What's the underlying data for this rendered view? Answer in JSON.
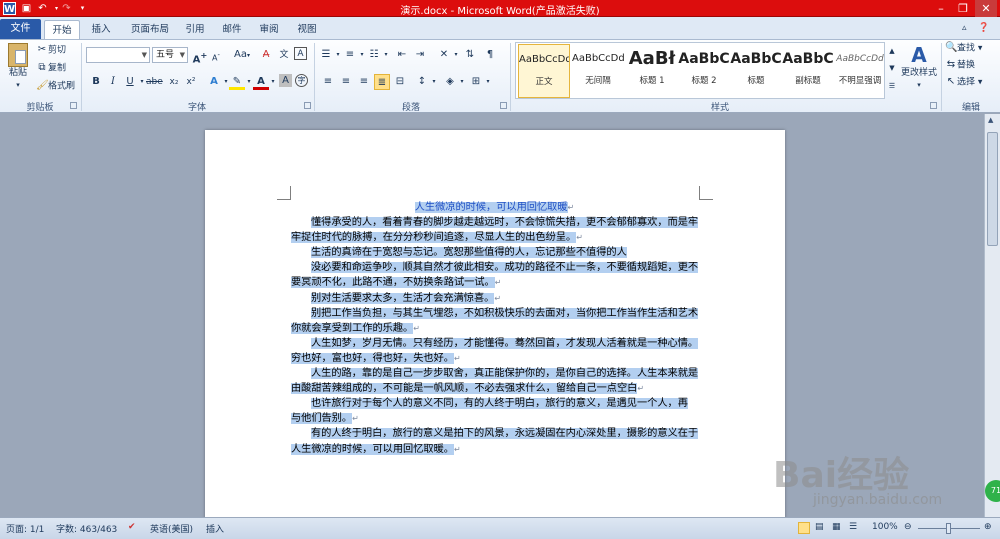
{
  "window": {
    "title": "演示.docx - Microsoft Word(产品激活失败)",
    "colors": {
      "titlebar": "#dc0d0d",
      "file_tab": "#2a5aa8",
      "selection": "#b3cff0",
      "doc_title_blue": "#1f4fc4"
    }
  },
  "quick_access": {
    "items": [
      "word-logo-icon",
      "save-icon",
      "undo-icon",
      "redo-icon",
      "customize-icon"
    ]
  },
  "tabs": {
    "file": "文件",
    "items": [
      {
        "label": "开始"
      },
      {
        "label": "插入"
      },
      {
        "label": "页面布局"
      },
      {
        "label": "引用"
      },
      {
        "label": "邮件"
      },
      {
        "label": "审阅"
      },
      {
        "label": "视图"
      }
    ],
    "active": "开始"
  },
  "ribbon": {
    "clipboard": {
      "paste": "粘贴",
      "cut": "剪切",
      "copy": "复制",
      "format_painter": "格式刷",
      "label": "剪贴板"
    },
    "font": {
      "font_name": "",
      "font_size": "五号",
      "change_case": "Aa",
      "label": "字体"
    },
    "paragraph": {
      "label": "段落"
    },
    "styles": {
      "items": [
        {
          "preview": "AaBbCcDd",
          "name": "正文"
        },
        {
          "preview": "AaBbCcDd",
          "name": "无间隔"
        },
        {
          "preview": "AaBł",
          "name": "标题 1"
        },
        {
          "preview": "AaBbC",
          "name": "标题 2"
        },
        {
          "preview": "AaBbC",
          "name": "标题"
        },
        {
          "preview": "AaBbC",
          "name": "副标题"
        },
        {
          "preview": "AaBbCcDd",
          "name": "不明显强调"
        }
      ],
      "selected": "正文",
      "change_styles": "更改样式",
      "label": "样式"
    },
    "editing": {
      "find": "查找",
      "replace": "替换",
      "select": "选择",
      "label": "编辑"
    }
  },
  "document": {
    "lines": [
      "人生微凉的时候，可以用回忆取暖",
      "懂得承受的人，看着青春的脚步越走越远时，不会惊慌失措，更不会郁郁寡欢，而是牢",
      "牢捉住时代的脉搏，在分分秒秒间追逐，尽显人生的出色纷呈。",
      "生活的真谛在于宽恕与忘记。宽恕那些值得的人，忘记那些不值得的人",
      "没必要和命运争吵，顺其自然才彼此相安。成功的路径不止一条，不要循规蹈矩，更不",
      "要冥顽不化，此路不通，不妨换条路试一试。",
      "别对生活要求太多，生活才会充满惊喜。",
      "别把工作当负担，与其生气埋怨，不如积极快乐的去面对，当你把工作当作生活和艺术，",
      "你就会享受到工作的乐趣。",
      "人生如梦，岁月无情。只有经历，才能懂得。蓦然回首，才发现人活着就是一种心情。",
      "穷也好，富也好，得也好，失也好。",
      "人生的路，靠的是自己一步步取舍，真正能保护你的，是你自己的选择。人生本来就是",
      "由酸甜苦辣组成的，不可能是一帆风顺，不必去强求什么，留给自己一点空白",
      "也许旅行对于每个人的意义不同，有的人终于明白，旅行的意义，是遇见一个人，再",
      "与他们告别。",
      "有的人终于明白，旅行的意义是拍下的风景，永远凝固在内心深处里，摄影的意义在于，",
      "人生微凉的时候，可以用回忆取暖。"
    ]
  },
  "statusbar": {
    "page": "页面: 1/1",
    "words": "字数: 463/463",
    "language": "英语(美国)",
    "mode": "插入",
    "zoom": "100%"
  },
  "watermark": {
    "text": "Bai经验",
    "url": "jingyan.baidu.com"
  },
  "badge": "71"
}
